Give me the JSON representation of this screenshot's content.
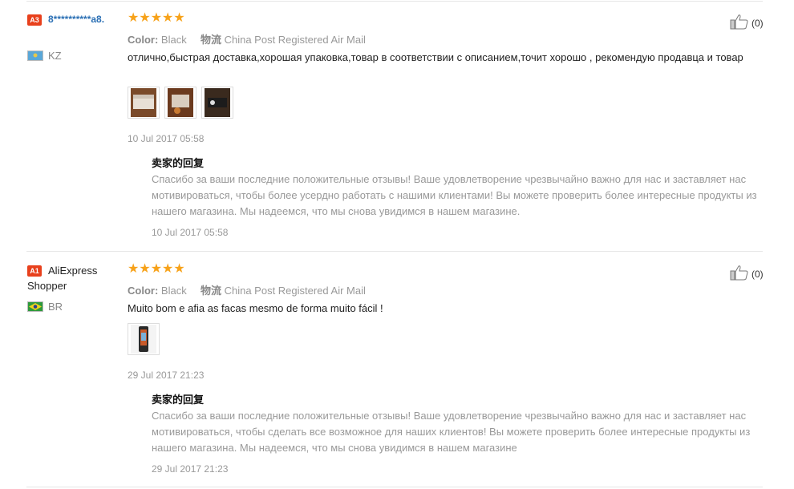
{
  "reviews": [
    {
      "level_badge": "A3",
      "name": "8**********a8.",
      "country_code": "KZ",
      "flag_colors": [
        "#5aa7d8",
        "#e8c84a"
      ],
      "stars": "★★★★★",
      "color_label": "Color:",
      "color_value": "Black",
      "shipping_label": "物流",
      "shipping_value": "China Post Registered Air Mail",
      "text": "отлично,быстрая доставка,хорошая упаковка,товар в соответствии с описанием,точит хорошо , рекомендую продавца и товар",
      "date": "10 Jul 2017 05:58",
      "reply_title": "卖家的回复",
      "reply_text": "Спасибо за ваши последние положительные отзывы! Ваше удовлетворение чрезвычайно важно для нас и заставляет нас мотивироваться, чтобы более усердно работать с нашими клиентами! Вы можете проверить более интересные продукты из нашего магазина. Мы надеемся, что мы снова увидимся в нашем магазине.",
      "reply_date": "10 Jul 2017 05:58",
      "helpful_count": "(0)"
    },
    {
      "level_badge": "A1",
      "name": "AliExpress Shopper",
      "country_code": "BR",
      "flag_colors": [
        "#2e9a3c",
        "#f0d21e"
      ],
      "stars": "★★★★★",
      "color_label": "Color:",
      "color_value": "Black",
      "shipping_label": "物流",
      "shipping_value": "China Post Registered Air Mail",
      "text": "Muito bom e afia as facas mesmo de forma muito fácil !",
      "date": "29 Jul 2017 21:23",
      "reply_title": "卖家的回复",
      "reply_text": "Спасибо за ваши последние положительные отзывы! Ваше удовлетворение чрезвычайно важно для нас и заставляет нас мотивироваться, чтобы сделать все возможное для наших клиентов! Вы можете проверить более интересные продукты из нашего магазина. Мы надеемся, что мы снова увидимся в нашем магазине",
      "reply_date": "29 Jul 2017 21:23",
      "helpful_count": "(0)"
    }
  ],
  "colors": {
    "accent_star": "#f7a21a",
    "badge": "#e8401c",
    "username_link": "#2a6fb4"
  }
}
